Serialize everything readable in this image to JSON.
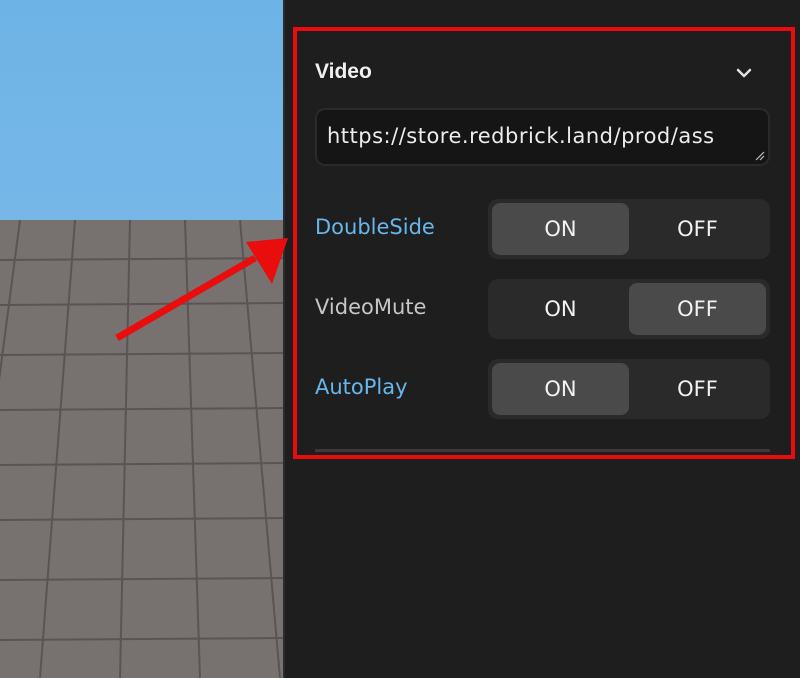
{
  "section": {
    "title": "Video",
    "collapse_icon": "chevron-down-icon"
  },
  "video_url": {
    "value": "https://store.redbrick.land/prod/ass"
  },
  "toggles": [
    {
      "label": "DoubleSide",
      "on_label": "ON",
      "off_label": "OFF",
      "selected": "ON"
    },
    {
      "label": "VideoMute",
      "on_label": "ON",
      "off_label": "OFF",
      "selected": "OFF"
    },
    {
      "label": "AutoPlay",
      "on_label": "ON",
      "off_label": "OFF",
      "selected": "ON"
    }
  ],
  "colors": {
    "panel_bg": "#1e1e1e",
    "active_label": "#67b7ec",
    "inactive_label": "#c6c6c6",
    "highlight_border": "#e90d0d",
    "annotation_arrow": "#e90d0d",
    "sky": "#6eb3e6",
    "ground": "#777170"
  }
}
